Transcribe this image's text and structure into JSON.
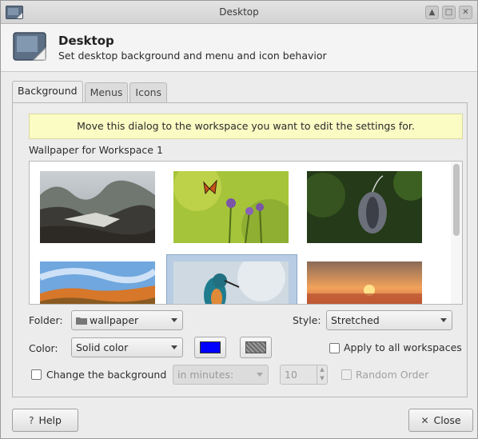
{
  "window": {
    "title": "Desktop"
  },
  "header": {
    "title": "Desktop",
    "subtitle": "Set desktop background and menu and icon behavior"
  },
  "tabs": [
    {
      "label": "Background",
      "active": true
    },
    {
      "label": "Menus",
      "active": false
    },
    {
      "label": "Icons",
      "active": false
    }
  ],
  "notice": "Move this dialog to the workspace you want to edit the settings for.",
  "wallpaper_label": "Wallpaper for Workspace 1",
  "folder": {
    "label": "Folder:",
    "value": "wallpaper",
    "icon": "folder-icon"
  },
  "style": {
    "label": "Style:",
    "value": "Stretched"
  },
  "color": {
    "label": "Color:",
    "value": "Solid color",
    "primary_color": "#0000ff"
  },
  "apply_all": {
    "label": "Apply to all workspaces",
    "checked": false
  },
  "change_bg": {
    "label": "Change the background",
    "checked": false,
    "interval_unit": "in minutes:",
    "interval_value": "10",
    "random_label": "Random Order"
  },
  "buttons": {
    "help": "Help",
    "close": "Close"
  },
  "colors": {
    "notice_bg": "#fbfbc4",
    "selection": "#b8cde3"
  }
}
